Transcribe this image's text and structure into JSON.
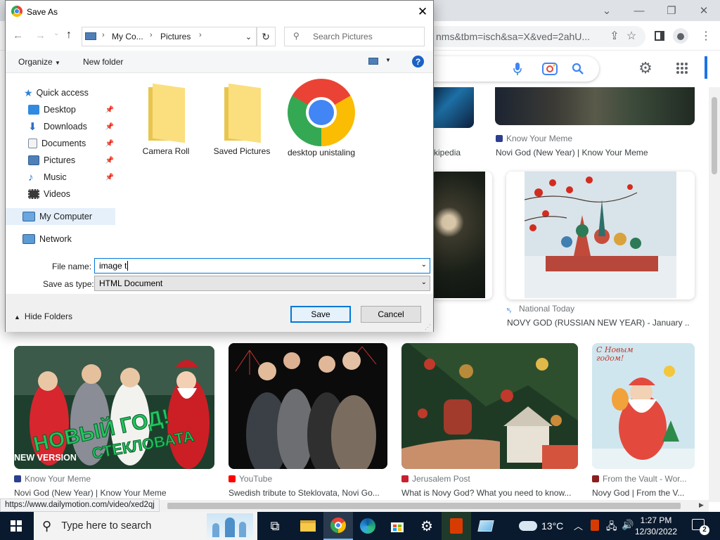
{
  "browser": {
    "url": "nms&tbm=isch&sa=X&ved=2ahU...",
    "status_url": "https://www.dailymotion.com/video/xed2qj"
  },
  "results": [
    {
      "source": "Know Your Meme",
      "title": "Novi God (New Year) | Know Your Meme"
    },
    {
      "source": "",
      "title": "kipedia"
    },
    {
      "source": "National Today",
      "title": "NOVY GOD (RUSSIAN NEW YEAR) - January ..."
    },
    {
      "source": "Know Your Meme",
      "title": "Novi God (New Year) | Know Your Meme",
      "overlay_top": "НОВЫЙ ГОД!",
      "overlay_bottom": "СТЕКЛОВАТА",
      "badge": "NEW VERSION"
    },
    {
      "source": "YouTube",
      "title": "Swedish tribute to Steklovata, Novi Go..."
    },
    {
      "source": "Jerusalem Post",
      "title": "What is Novy God? What you need to know..."
    },
    {
      "source": "From the Vault - Wor...",
      "title": "Novy God | From the V...",
      "card_text": "С Новым годом!"
    }
  ],
  "dialog": {
    "title": "Save As",
    "breadcrumb": [
      "My Co...",
      "Pictures"
    ],
    "search_placeholder": "Search Pictures",
    "organize": "Organize",
    "new_folder": "New folder",
    "nav": {
      "quick_access": "Quick access",
      "items": [
        "Desktop",
        "Downloads",
        "Documents",
        "Pictures",
        "Music",
        "Videos"
      ],
      "my_computer": "My Computer",
      "network": "Network"
    },
    "files": [
      "Camera Roll",
      "Saved Pictures",
      "desktop unistaling"
    ],
    "file_name_label": "File name:",
    "file_name_value": "image t",
    "save_type_label": "Save as type:",
    "save_type_value": "HTML Document",
    "hide_folders": "Hide Folders",
    "save": "Save",
    "cancel": "Cancel"
  },
  "taskbar": {
    "search_placeholder": "Type here to search",
    "weather": "13°C",
    "time": "1:27 PM",
    "date": "12/30/2022",
    "notifications": "2"
  }
}
